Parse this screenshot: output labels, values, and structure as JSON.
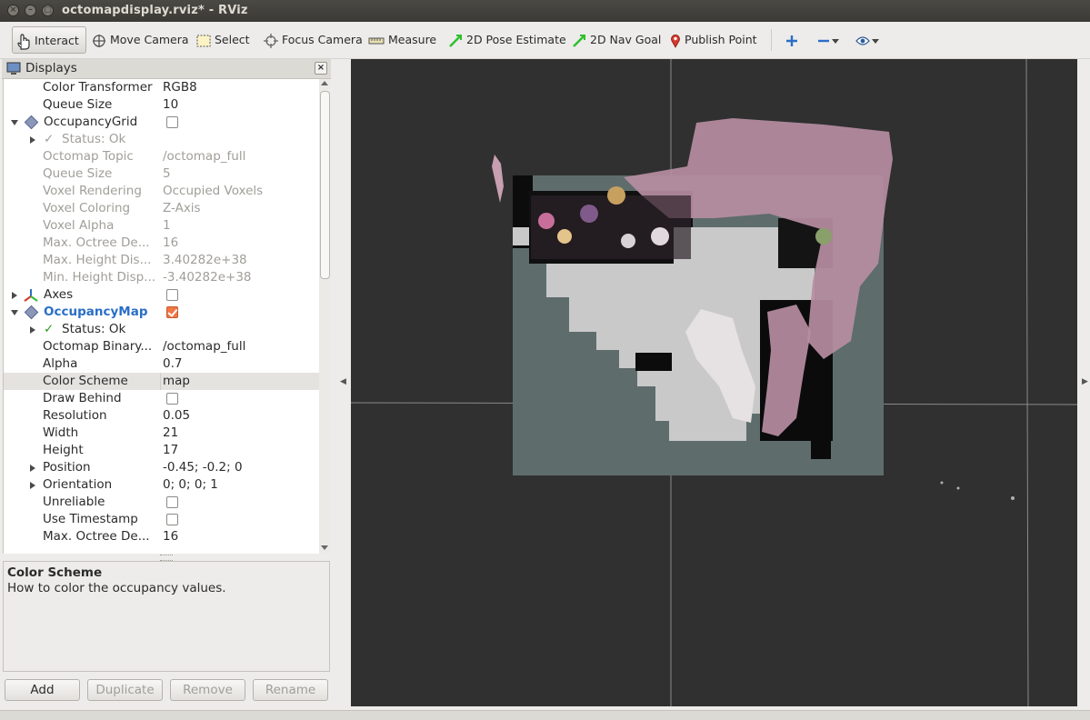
{
  "window": {
    "title": "octomapdisplay.rviz* - RViz"
  },
  "toolbar": {
    "interact": "Interact",
    "move_camera": "Move Camera",
    "select": "Select",
    "focus_camera": "Focus Camera",
    "measure": "Measure",
    "pose_estimate": "2D Pose Estimate",
    "nav_goal": "2D Nav Goal",
    "publish_point": "Publish Point"
  },
  "displays_panel": {
    "title": "Displays",
    "rows": {
      "color_transformer": {
        "name": "Color Transformer",
        "value": "RGB8"
      },
      "queue_size_top": {
        "name": "Queue Size",
        "value": "10"
      },
      "occupancy_grid": {
        "name": "OccupancyGrid"
      },
      "grid_status": {
        "name": "Status: Ok"
      },
      "octomap_topic": {
        "name": "Octomap Topic",
        "value": "/octomap_full"
      },
      "grid_queue_size": {
        "name": "Queue Size",
        "value": "5"
      },
      "voxel_rendering": {
        "name": "Voxel Rendering",
        "value": "Occupied Voxels"
      },
      "voxel_coloring": {
        "name": "Voxel Coloring",
        "value": "Z-Axis"
      },
      "voxel_alpha": {
        "name": "Voxel Alpha",
        "value": "1"
      },
      "max_octree_depth_grid": {
        "name": "Max. Octree De...",
        "value": "16"
      },
      "max_height": {
        "name": "Max. Height Dis...",
        "value": "3.40282e+38"
      },
      "min_height": {
        "name": "Min. Height Disp...",
        "value": "-3.40282e+38"
      },
      "axes": {
        "name": "Axes"
      },
      "occupancy_map": {
        "name": "OccupancyMap"
      },
      "map_status": {
        "name": "Status: Ok"
      },
      "octomap_binary": {
        "name": "Octomap Binary...",
        "value": "/octomap_full"
      },
      "alpha": {
        "name": "Alpha",
        "value": "0.7"
      },
      "color_scheme": {
        "name": "Color Scheme",
        "value": "map"
      },
      "draw_behind": {
        "name": "Draw Behind"
      },
      "resolution": {
        "name": "Resolution",
        "value": "0.05"
      },
      "width": {
        "name": "Width",
        "value": "21"
      },
      "height": {
        "name": "Height",
        "value": "17"
      },
      "position": {
        "name": "Position",
        "value": "-0.45; -0.2; 0"
      },
      "orientation": {
        "name": "Orientation",
        "value": "0; 0; 0; 1"
      },
      "unreliable": {
        "name": "Unreliable"
      },
      "use_timestamp": {
        "name": "Use Timestamp"
      },
      "max_octree_depth_map": {
        "name": "Max. Octree De...",
        "value": "16"
      }
    }
  },
  "description": {
    "title": "Color Scheme",
    "text": "How to color the occupancy values."
  },
  "buttons": {
    "add": "Add",
    "duplicate": "Duplicate",
    "remove": "Remove",
    "rename": "Rename"
  },
  "colors": {
    "viewport_bg": "#303030",
    "map_occupied_dark": "#5e6c6c",
    "map_free_light": "#c9c9c9",
    "cloud_pink": "#b78ea2",
    "highlight_blue": "#2a6ec7",
    "checkbox_checked": "#f07746"
  }
}
